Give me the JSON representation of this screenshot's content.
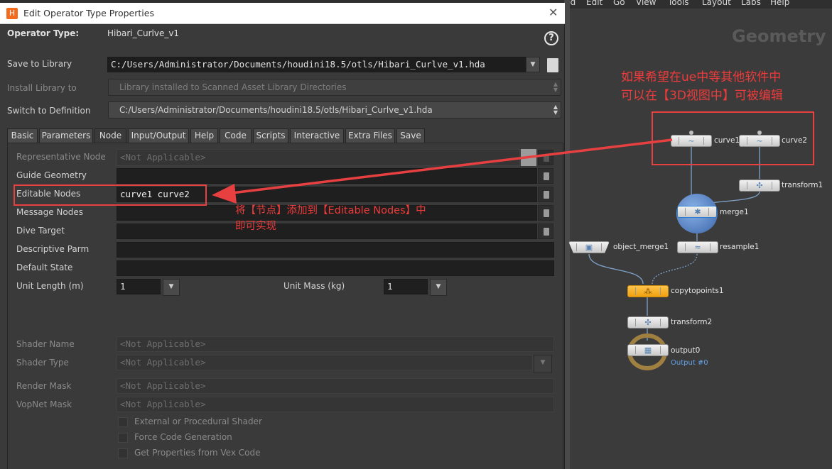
{
  "menubar": [
    "Add",
    "Edit",
    "Go",
    "View",
    "Tools",
    "Layout",
    "Labs",
    "Help"
  ],
  "network": {
    "context_title": "Geometry",
    "nodes": [
      {
        "name": "curve1"
      },
      {
        "name": "curve2"
      },
      {
        "name": "transform1"
      },
      {
        "name": "merge1"
      },
      {
        "name": "object_merge1"
      },
      {
        "name": "resample1"
      },
      {
        "name": "copytopoints1"
      },
      {
        "name": "transform2"
      },
      {
        "name": "output0",
        "sublabel": "Output #0"
      }
    ]
  },
  "dialog": {
    "title": "Edit Operator Type Properties",
    "operator_type_label": "Operator Type:",
    "operator_type_value": "Hibari_Curlve_v1",
    "help_icon": "?",
    "save_to_library_label": "Save to Library",
    "save_to_library_value": "C:/Users/Administrator/Documents/houdini18.5/otls/Hibari_Curlve_v1.hda",
    "install_library_label": "Install Library to",
    "install_library_value": "Library installed to Scanned Asset Library Directories",
    "switch_definition_label": "Switch to Definition",
    "switch_definition_value": "C:/Users/Administrator/Documents/houdini18.5/otls/Hibari_Curlve_v1.hda",
    "tabs": [
      "Basic",
      "Parameters",
      "Node",
      "Input/Output",
      "Help",
      "Code",
      "Scripts",
      "Interactive",
      "Extra Files",
      "Save"
    ],
    "active_tab": "Node",
    "node_tab": {
      "representative_node": {
        "label": "Representative Node",
        "value": "<Not Applicable>"
      },
      "guide_geometry": {
        "label": "Guide Geometry",
        "value": ""
      },
      "editable_nodes": {
        "label": "Editable Nodes",
        "value": "curve1 curve2"
      },
      "message_nodes": {
        "label": "Message Nodes",
        "value": ""
      },
      "dive_target": {
        "label": "Dive Target",
        "value": ""
      },
      "descriptive_parm": {
        "label": "Descriptive Parm",
        "value": ""
      },
      "default_state": {
        "label": "Default State",
        "value": ""
      },
      "unit_length": {
        "label": "Unit Length (m)",
        "value": "1"
      },
      "unit_mass": {
        "label": "Unit Mass (kg)",
        "value": "1"
      },
      "shader_name": {
        "label": "Shader Name",
        "value": "<Not Applicable>"
      },
      "shader_type": {
        "label": "Shader Type",
        "value": "<Not Applicable>"
      },
      "render_mask": {
        "label": "Render Mask",
        "value": "<Not Applicable>"
      },
      "vopnet_mask": {
        "label": "VopNet Mask",
        "value": "<Not Applicable>"
      },
      "checkboxes": [
        {
          "label": "External or Procedural Shader",
          "checked": false
        },
        {
          "label": "Force Code Generation",
          "checked": false
        },
        {
          "label": "Get Properties from Vex Code",
          "checked": false
        }
      ]
    }
  },
  "annotations": {
    "editable_nodes_note_line1": "将【节点】添加到【Editable Nodes】中",
    "editable_nodes_note_line2": "即可实现",
    "network_note_line1": "如果希望在ue中等其他软件中",
    "network_note_line2": "可以在【3D视图中】可被编辑",
    "color": "#ee3b3b"
  }
}
